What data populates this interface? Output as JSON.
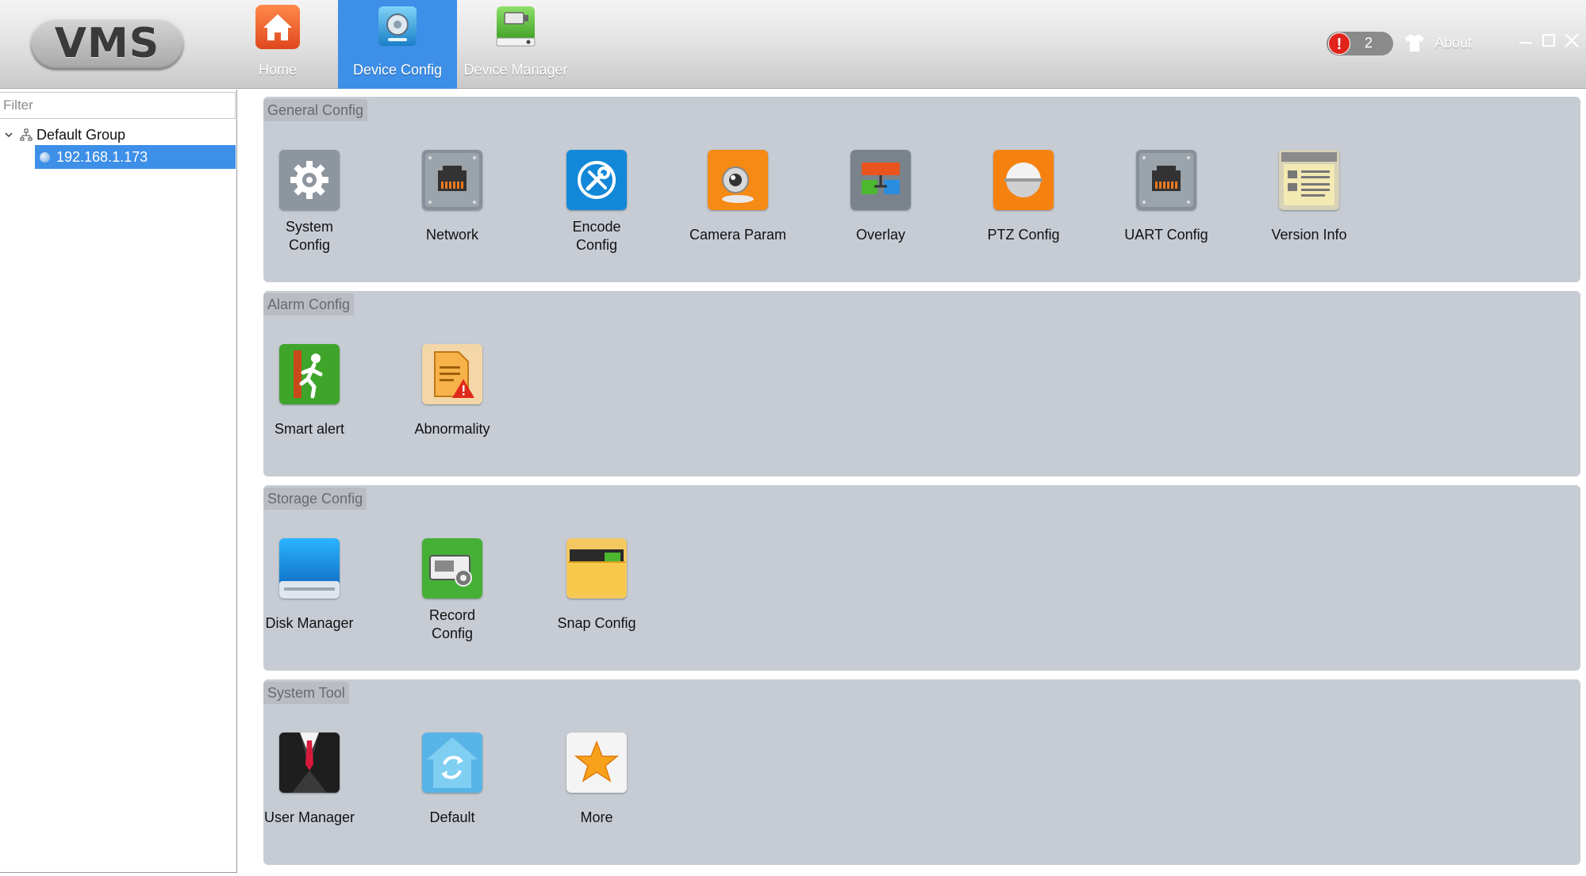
{
  "app": {
    "logo": "VMS"
  },
  "nav": {
    "tabs": [
      {
        "label": "Home",
        "icon": "home-icon",
        "active": false
      },
      {
        "label": "Device Config",
        "icon": "device-config-icon",
        "active": true
      },
      {
        "label": "Device Manager",
        "icon": "device-manager-icon",
        "active": false
      }
    ]
  },
  "topright": {
    "alert_count": "2",
    "alert_glyph": "!",
    "about_label": "About"
  },
  "sidebar": {
    "filter_placeholder": "Filter",
    "group_label": "Default Group",
    "device_label": "192.168.1.173"
  },
  "sections": [
    {
      "title": "General Config",
      "items": [
        {
          "label": "System\nConfig",
          "icon": "gear-icon"
        },
        {
          "label": "Network",
          "icon": "network-port-icon"
        },
        {
          "label": "Encode\nConfig",
          "icon": "tools-icon"
        },
        {
          "label": "Camera Param",
          "icon": "webcam-icon"
        },
        {
          "label": "Overlay",
          "icon": "overlay-blocks-icon"
        },
        {
          "label": "PTZ Config",
          "icon": "dome-camera-icon"
        },
        {
          "label": "UART Config",
          "icon": "uart-port-icon"
        },
        {
          "label": "Version Info",
          "icon": "document-info-icon"
        }
      ]
    },
    {
      "title": "Alarm Config",
      "items": [
        {
          "label": "Smart alert",
          "icon": "running-man-icon"
        },
        {
          "label": "Abnormality",
          "icon": "warning-document-icon"
        }
      ]
    },
    {
      "title": "Storage Config",
      "items": [
        {
          "label": "Disk Manager",
          "icon": "disk-icon"
        },
        {
          "label": "Record\nConfig",
          "icon": "recorder-gear-icon"
        },
        {
          "label": "Snap Config",
          "icon": "folder-icon"
        }
      ]
    },
    {
      "title": "System Tool",
      "items": [
        {
          "label": "User Manager",
          "icon": "user-suit-icon"
        },
        {
          "label": "Default",
          "icon": "house-refresh-icon"
        },
        {
          "label": "More",
          "icon": "star-icon"
        }
      ]
    }
  ]
}
